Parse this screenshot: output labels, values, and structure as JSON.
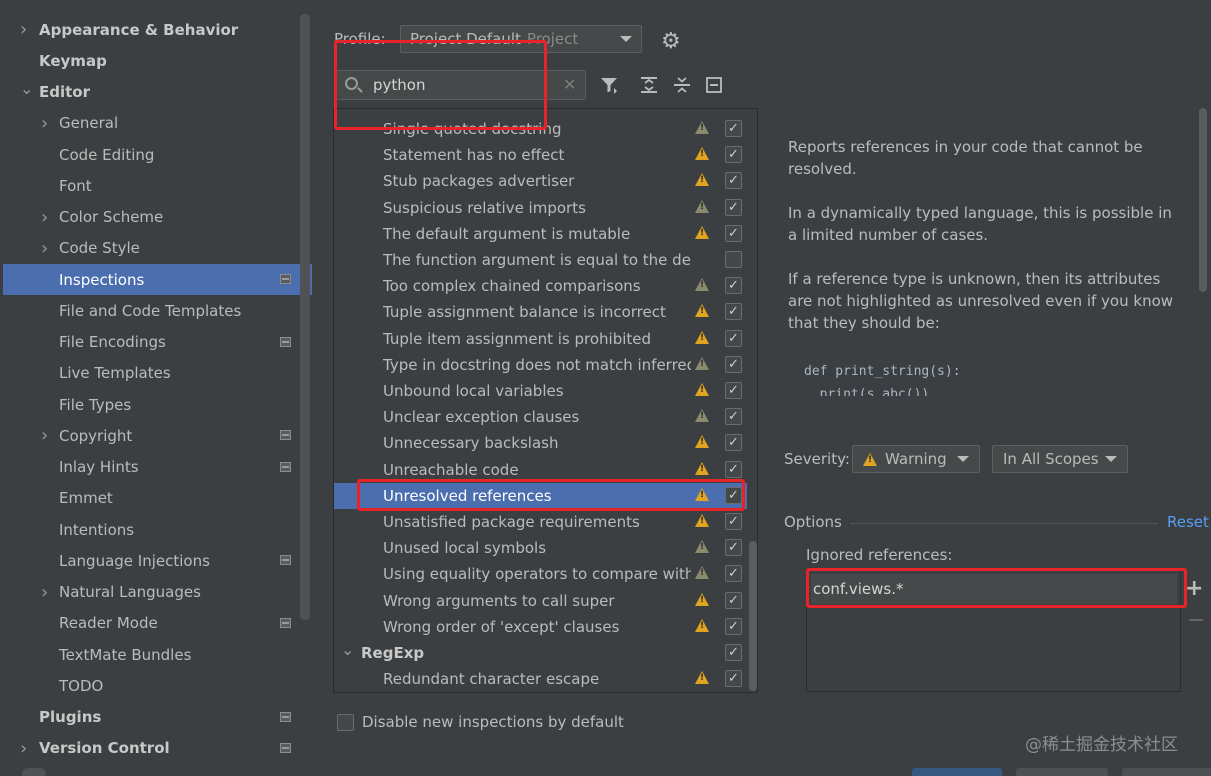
{
  "sidebar": {
    "items": [
      {
        "label": "Appearance & Behavior",
        "level": 0,
        "bold": true,
        "chevron": "right",
        "project_icon": false
      },
      {
        "label": "Keymap",
        "level": 0,
        "bold": true,
        "chevron": "",
        "project_icon": false
      },
      {
        "label": "Editor",
        "level": 0,
        "bold": true,
        "chevron": "down",
        "project_icon": false
      },
      {
        "label": "General",
        "level": 1,
        "bold": false,
        "chevron": "right",
        "project_icon": false
      },
      {
        "label": "Code Editing",
        "level": 1,
        "bold": false,
        "chevron": "",
        "project_icon": false
      },
      {
        "label": "Font",
        "level": 1,
        "bold": false,
        "chevron": "",
        "project_icon": false
      },
      {
        "label": "Color Scheme",
        "level": 1,
        "bold": false,
        "chevron": "right",
        "project_icon": false
      },
      {
        "label": "Code Style",
        "level": 1,
        "bold": false,
        "chevron": "right",
        "project_icon": false
      },
      {
        "label": "Inspections",
        "level": 1,
        "bold": false,
        "chevron": "",
        "project_icon": true,
        "selected": true
      },
      {
        "label": "File and Code Templates",
        "level": 1,
        "bold": false,
        "chevron": "",
        "project_icon": false
      },
      {
        "label": "File Encodings",
        "level": 1,
        "bold": false,
        "chevron": "",
        "project_icon": true
      },
      {
        "label": "Live Templates",
        "level": 1,
        "bold": false,
        "chevron": "",
        "project_icon": false
      },
      {
        "label": "File Types",
        "level": 1,
        "bold": false,
        "chevron": "",
        "project_icon": false
      },
      {
        "label": "Copyright",
        "level": 1,
        "bold": false,
        "chevron": "right",
        "project_icon": true
      },
      {
        "label": "Inlay Hints",
        "level": 1,
        "bold": false,
        "chevron": "",
        "project_icon": true
      },
      {
        "label": "Emmet",
        "level": 1,
        "bold": false,
        "chevron": "",
        "project_icon": false
      },
      {
        "label": "Intentions",
        "level": 1,
        "bold": false,
        "chevron": "",
        "project_icon": false
      },
      {
        "label": "Language Injections",
        "level": 1,
        "bold": false,
        "chevron": "",
        "project_icon": true
      },
      {
        "label": "Natural Languages",
        "level": 1,
        "bold": false,
        "chevron": "right",
        "project_icon": false
      },
      {
        "label": "Reader Mode",
        "level": 1,
        "bold": false,
        "chevron": "",
        "project_icon": true
      },
      {
        "label": "TextMate Bundles",
        "level": 1,
        "bold": false,
        "chevron": "",
        "project_icon": false
      },
      {
        "label": "TODO",
        "level": 1,
        "bold": false,
        "chevron": "",
        "project_icon": false
      },
      {
        "label": "Plugins",
        "level": 0,
        "bold": true,
        "chevron": "",
        "project_icon": true
      },
      {
        "label": "Version Control",
        "level": 0,
        "bold": true,
        "chevron": "right",
        "project_icon": true
      }
    ]
  },
  "profile": {
    "label": "Profile:",
    "value": "Project Default",
    "scope": "Project"
  },
  "search": {
    "value": "python"
  },
  "inspections": [
    {
      "label": "Single quoted docstring",
      "type": "item",
      "severity": "weak",
      "checked": true
    },
    {
      "label": "Statement has no effect",
      "type": "item",
      "severity": "warning",
      "checked": true
    },
    {
      "label": "Stub packages advertiser",
      "type": "item",
      "severity": "warning",
      "checked": true
    },
    {
      "label": "Suspicious relative imports",
      "type": "item",
      "severity": "weak",
      "checked": true
    },
    {
      "label": "The default argument is mutable",
      "type": "item",
      "severity": "warning",
      "checked": true
    },
    {
      "label": "The function argument is equal to the default",
      "type": "item",
      "severity": "none",
      "checked": false
    },
    {
      "label": "Too complex chained comparisons",
      "type": "item",
      "severity": "weak",
      "checked": true
    },
    {
      "label": "Tuple assignment balance is incorrect",
      "type": "item",
      "severity": "warning",
      "checked": true
    },
    {
      "label": "Tuple item assignment is prohibited",
      "type": "item",
      "severity": "warning",
      "checked": true
    },
    {
      "label": "Type in docstring does not match inferred type",
      "type": "item",
      "severity": "weak",
      "checked": true
    },
    {
      "label": "Unbound local variables",
      "type": "item",
      "severity": "warning",
      "checked": true
    },
    {
      "label": "Unclear exception clauses",
      "type": "item",
      "severity": "weak",
      "checked": true
    },
    {
      "label": "Unnecessary backslash",
      "type": "item",
      "severity": "warning",
      "checked": true
    },
    {
      "label": "Unreachable code",
      "type": "item",
      "severity": "warning",
      "checked": true
    },
    {
      "label": "Unresolved references",
      "type": "item",
      "severity": "warning",
      "checked": true,
      "selected": true
    },
    {
      "label": "Unsatisfied package requirements",
      "type": "item",
      "severity": "warning",
      "checked": true
    },
    {
      "label": "Unused local symbols",
      "type": "item",
      "severity": "weak",
      "checked": true
    },
    {
      "label": "Using equality operators to compare with None",
      "type": "item",
      "severity": "weak",
      "checked": true
    },
    {
      "label": "Wrong arguments to call super",
      "type": "item",
      "severity": "warning",
      "checked": true
    },
    {
      "label": "Wrong order of 'except' clauses",
      "type": "item",
      "severity": "warning",
      "checked": true
    },
    {
      "label": "RegExp",
      "type": "group",
      "severity": "none",
      "checked": true
    },
    {
      "label": "Redundant character escape",
      "type": "item",
      "severity": "warning",
      "checked": true
    }
  ],
  "disable_new": {
    "label": "Disable new inspections by default",
    "checked": false
  },
  "description": {
    "paragraphs": [
      "Reports references in your code that cannot be resolved.",
      "In a dynamically typed language, this is possible in a limited number of cases.",
      "If a reference type is unknown, then its attributes are not highlighted as unresolved even if you know that they should be:"
    ],
    "code": "def print_string(s):\n  print(s.abc())"
  },
  "severity": {
    "label": "Severity:",
    "value": "Warning",
    "scope": "In All Scopes"
  },
  "options": {
    "label": "Options",
    "reset": "Reset",
    "ignored_label": "Ignored references:",
    "ignored_items": [
      "conf.views.*"
    ],
    "add": "+",
    "remove": "−"
  },
  "watermark": "@稀土掘金技术社区",
  "colors": {
    "accent": "#4b6eaf",
    "warning": "#e0a520",
    "annotation": "#e8242b",
    "link": "#589df6"
  }
}
